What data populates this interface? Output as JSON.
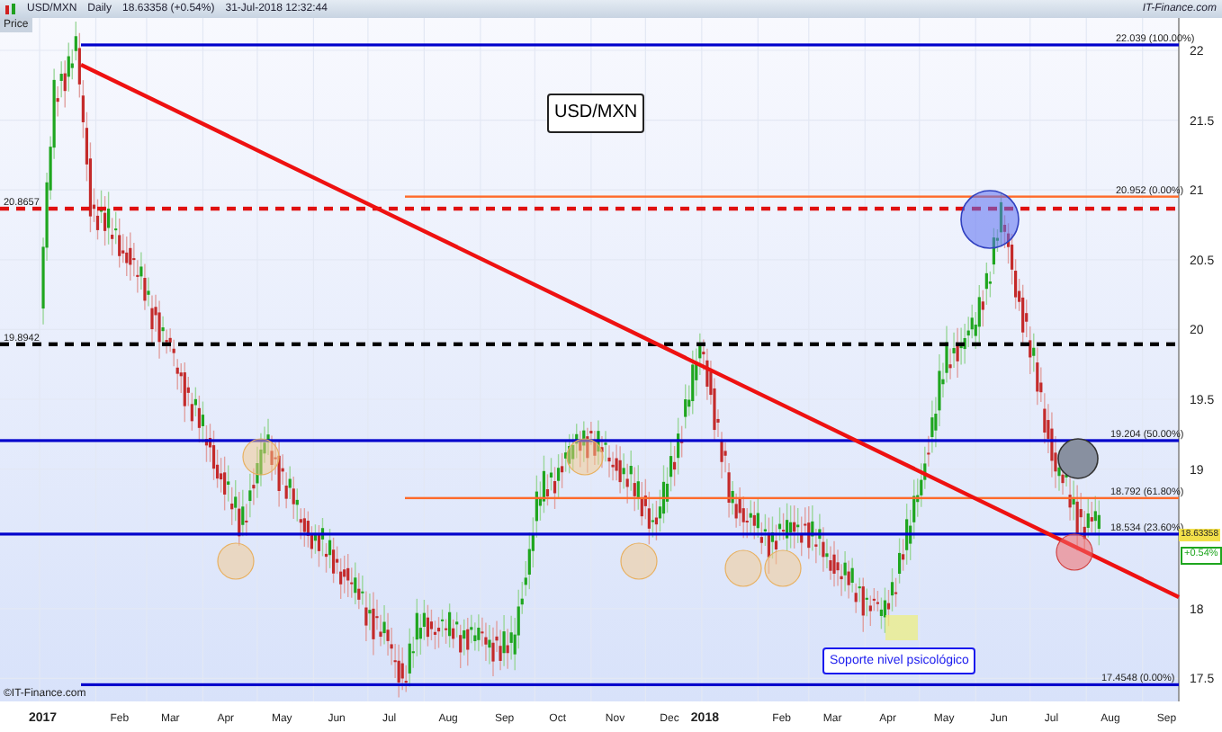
{
  "header": {
    "symbol": "USD/MXN",
    "period": "Daily",
    "price": "18.63358",
    "change": "(+0.54%)",
    "datetime": "31-Jul-2018 12:32:44",
    "brand": "IT-Finance.com"
  },
  "chart": {
    "axis_label": "Price",
    "title": "USD/MXN",
    "y_ticks": [
      "22",
      "21.5",
      "21",
      "20.5",
      "20",
      "19.5",
      "19",
      "18",
      "17.5"
    ],
    "x_ticks": [
      "2017",
      "Feb",
      "Mar",
      "Apr",
      "May",
      "Jun",
      "Jul",
      "Aug",
      "Sep",
      "Oct",
      "Nov",
      "Dec",
      "2018",
      "Feb",
      "Mar",
      "Apr",
      "May",
      "Jun",
      "Jul",
      "Aug",
      "Sep"
    ],
    "levels": [
      {
        "kind": "solid",
        "color": "#0000cc",
        "label": "22.039 (100.00%)"
      },
      {
        "kind": "solid",
        "color": "#ff6a2a",
        "label": "20.952 (0.00%)"
      },
      {
        "kind": "dashed",
        "color": "#e01010",
        "label": "20.8657"
      },
      {
        "kind": "dashed",
        "color": "#000000",
        "label": "19.8942"
      },
      {
        "kind": "solid",
        "color": "#0000cc",
        "label": "19.204 (50.00%)"
      },
      {
        "kind": "solid",
        "color": "#ff6a2a",
        "label": "18.792 (61.80%)"
      },
      {
        "kind": "solid",
        "color": "#0000cc",
        "label": "18.534 (23.60%)"
      },
      {
        "kind": "solid",
        "color": "#0000cc",
        "label": "17.4548 (0.00%)"
      }
    ],
    "price_tag": "18.63358",
    "change_tag": "+0.54%",
    "callout": "Soporte nivel psicológico",
    "copyright": "©IT-Finance.com"
  }
}
